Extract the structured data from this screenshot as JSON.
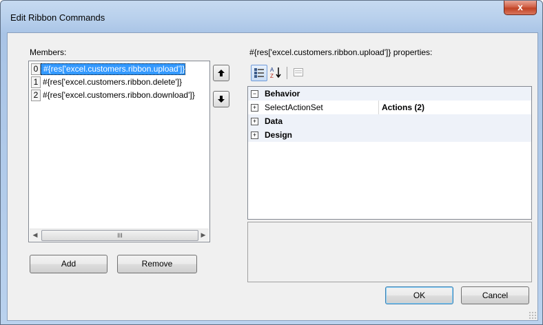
{
  "window": {
    "title": "Edit Ribbon Commands",
    "close_glyph": "x"
  },
  "members": {
    "label": "Members:",
    "items": [
      {
        "index": "0",
        "text": "#{res['excel.customers.ribbon.upload']}",
        "selected": true
      },
      {
        "index": "1",
        "text": "#{res['excel.customers.ribbon.delete']}",
        "selected": false
      },
      {
        "index": "2",
        "text": "#{res['excel.customers.ribbon.download']}",
        "selected": false
      }
    ],
    "scroll_left": "◀",
    "scroll_right": "▶",
    "scroll_thumb": "III"
  },
  "move": {
    "up_glyph": "🡅",
    "down_glyph": "🡇"
  },
  "buttons": {
    "add": "Add",
    "remove": "Remove",
    "ok": "OK",
    "cancel": "Cancel"
  },
  "properties": {
    "label": "#{res['excel.customers.ribbon.upload']} properties:",
    "toolbar": {
      "categorized_icon": "categorized-icon",
      "alphabetical_icon": "alphabetical-icon",
      "property_pages_icon": "property-pages-icon",
      "alpha_top": "A",
      "alpha_bottom": "Z"
    },
    "grid": [
      {
        "kind": "category",
        "expander": "⊟",
        "name": "Behavior"
      },
      {
        "kind": "property",
        "expander": "⊞",
        "name": "SelectActionSet",
        "value": "Actions (2)"
      },
      {
        "kind": "category",
        "expander": "⊞",
        "name": "Data"
      },
      {
        "kind": "category",
        "expander": "⊞",
        "name": "Design"
      }
    ],
    "description": ""
  }
}
